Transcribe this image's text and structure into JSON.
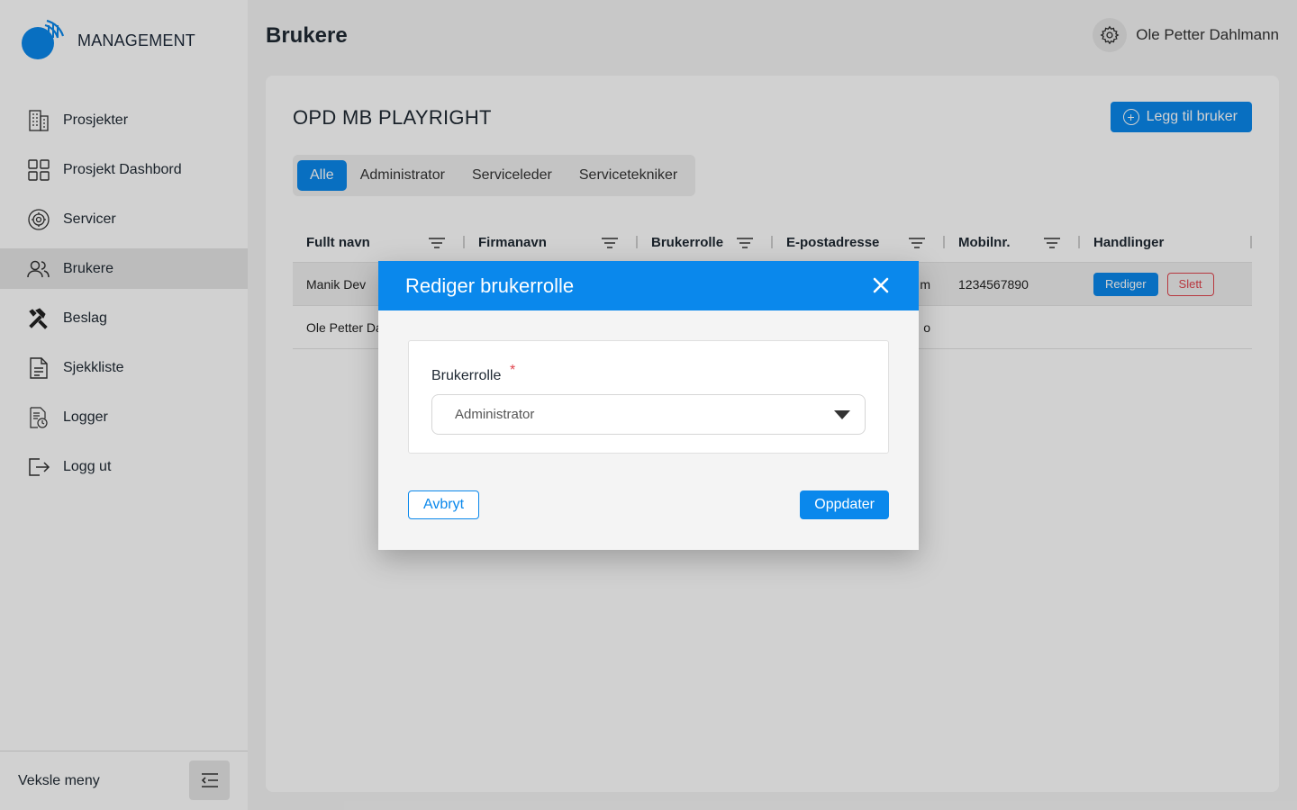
{
  "app": {
    "logo_text": "MANAGEMENT",
    "page_title": "Brukere",
    "user_name": "Ole Petter Dahlmann"
  },
  "sidebar": {
    "items": [
      {
        "label": "Prosjekter",
        "icon": "building-icon"
      },
      {
        "label": "Prosjekt Dashbord",
        "icon": "grid-icon"
      },
      {
        "label": "Servicer",
        "icon": "gear-circle-icon"
      },
      {
        "label": "Brukere",
        "icon": "users-icon",
        "active": true
      },
      {
        "label": "Beslag",
        "icon": "tools-icon"
      },
      {
        "label": "Sjekkliste",
        "icon": "document-icon"
      },
      {
        "label": "Logger",
        "icon": "log-icon"
      },
      {
        "label": "Logg ut",
        "icon": "logout-icon"
      }
    ],
    "footer_label": "Veksle meny"
  },
  "main": {
    "project_title": "OPD MB PLAYRIGHT",
    "add_user_label": "Legg til bruker",
    "tabs": [
      "Alle",
      "Administrator",
      "Serviceleder",
      "Servicetekniker"
    ],
    "active_tab": "Alle",
    "table": {
      "headers": [
        "Fullt navn",
        "Firmanavn",
        "Brukerrolle",
        "E-postadresse",
        "Mobilnr.",
        "Handlinger"
      ],
      "rows": [
        {
          "name": "Manik Dev",
          "email_tail": "m",
          "mobile": "1234567890"
        },
        {
          "name": "Ole Petter Da",
          "email_tail": "o",
          "mobile": ""
        }
      ],
      "edit_label": "Rediger",
      "delete_label": "Slett"
    }
  },
  "modal": {
    "title": "Rediger brukerrolle",
    "field_label": "Brukerrolle",
    "required_mark": "*",
    "selected_value": "Administrator",
    "cancel_label": "Avbryt",
    "update_label": "Oppdater"
  },
  "colors": {
    "accent": "#0a88ec",
    "danger": "#e0454e"
  }
}
